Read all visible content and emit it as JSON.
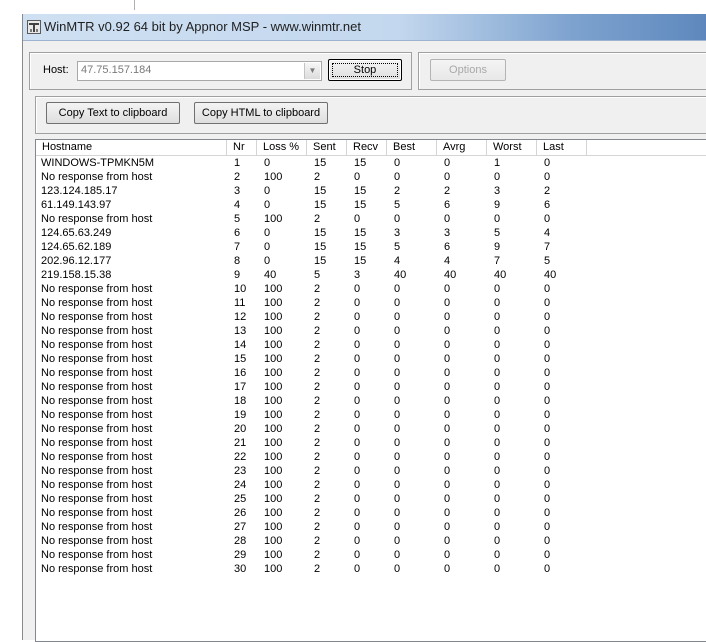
{
  "window": {
    "title": "WinMTR v0.92 64 bit by Appnor MSP - www.winmtr.net",
    "icon": "winmtr-app-icon"
  },
  "host_panel": {
    "host_label": "Host:",
    "host_value": "47.75.157.184",
    "stop_button": "Stop",
    "options_button": "Options"
  },
  "clipboard_panel": {
    "copy_text_button": "Copy Text to clipboard",
    "copy_html_button": "Copy HTML to clipboard"
  },
  "table": {
    "columns": [
      "Hostname",
      "Nr",
      "Loss %",
      "Sent",
      "Recv",
      "Best",
      "Avrg",
      "Worst",
      "Last"
    ],
    "rows": [
      [
        "WINDOWS-TPMKN5M",
        "1",
        "0",
        "15",
        "15",
        "0",
        "0",
        "1",
        "0"
      ],
      [
        "No response from host",
        "2",
        "100",
        "2",
        "0",
        "0",
        "0",
        "0",
        "0"
      ],
      [
        "123.124.185.17",
        "3",
        "0",
        "15",
        "15",
        "2",
        "2",
        "3",
        "2"
      ],
      [
        "61.149.143.97",
        "4",
        "0",
        "15",
        "15",
        "5",
        "6",
        "9",
        "6"
      ],
      [
        "No response from host",
        "5",
        "100",
        "2",
        "0",
        "0",
        "0",
        "0",
        "0"
      ],
      [
        "124.65.63.249",
        "6",
        "0",
        "15",
        "15",
        "3",
        "3",
        "5",
        "4"
      ],
      [
        "124.65.62.189",
        "7",
        "0",
        "15",
        "15",
        "5",
        "6",
        "9",
        "7"
      ],
      [
        "202.96.12.177",
        "8",
        "0",
        "15",
        "15",
        "4",
        "4",
        "7",
        "5"
      ],
      [
        "219.158.15.38",
        "9",
        "40",
        "5",
        "3",
        "40",
        "40",
        "40",
        "40"
      ],
      [
        "No response from host",
        "10",
        "100",
        "2",
        "0",
        "0",
        "0",
        "0",
        "0"
      ],
      [
        "No response from host",
        "11",
        "100",
        "2",
        "0",
        "0",
        "0",
        "0",
        "0"
      ],
      [
        "No response from host",
        "12",
        "100",
        "2",
        "0",
        "0",
        "0",
        "0",
        "0"
      ],
      [
        "No response from host",
        "13",
        "100",
        "2",
        "0",
        "0",
        "0",
        "0",
        "0"
      ],
      [
        "No response from host",
        "14",
        "100",
        "2",
        "0",
        "0",
        "0",
        "0",
        "0"
      ],
      [
        "No response from host",
        "15",
        "100",
        "2",
        "0",
        "0",
        "0",
        "0",
        "0"
      ],
      [
        "No response from host",
        "16",
        "100",
        "2",
        "0",
        "0",
        "0",
        "0",
        "0"
      ],
      [
        "No response from host",
        "17",
        "100",
        "2",
        "0",
        "0",
        "0",
        "0",
        "0"
      ],
      [
        "No response from host",
        "18",
        "100",
        "2",
        "0",
        "0",
        "0",
        "0",
        "0"
      ],
      [
        "No response from host",
        "19",
        "100",
        "2",
        "0",
        "0",
        "0",
        "0",
        "0"
      ],
      [
        "No response from host",
        "20",
        "100",
        "2",
        "0",
        "0",
        "0",
        "0",
        "0"
      ],
      [
        "No response from host",
        "21",
        "100",
        "2",
        "0",
        "0",
        "0",
        "0",
        "0"
      ],
      [
        "No response from host",
        "22",
        "100",
        "2",
        "0",
        "0",
        "0",
        "0",
        "0"
      ],
      [
        "No response from host",
        "23",
        "100",
        "2",
        "0",
        "0",
        "0",
        "0",
        "0"
      ],
      [
        "No response from host",
        "24",
        "100",
        "2",
        "0",
        "0",
        "0",
        "0",
        "0"
      ],
      [
        "No response from host",
        "25",
        "100",
        "2",
        "0",
        "0",
        "0",
        "0",
        "0"
      ],
      [
        "No response from host",
        "26",
        "100",
        "2",
        "0",
        "0",
        "0",
        "0",
        "0"
      ],
      [
        "No response from host",
        "27",
        "100",
        "2",
        "0",
        "0",
        "0",
        "0",
        "0"
      ],
      [
        "No response from host",
        "28",
        "100",
        "2",
        "0",
        "0",
        "0",
        "0",
        "0"
      ],
      [
        "No response from host",
        "29",
        "100",
        "2",
        "0",
        "0",
        "0",
        "0",
        "0"
      ],
      [
        "No response from host",
        "30",
        "100",
        "2",
        "0",
        "0",
        "0",
        "0",
        "0"
      ]
    ]
  },
  "colors": {
    "window_bg": "#f0f0f0",
    "titlebar_accent": "#5e88bd",
    "list_bg": "#ffffff",
    "disabled_text": "#a8a8a8"
  }
}
